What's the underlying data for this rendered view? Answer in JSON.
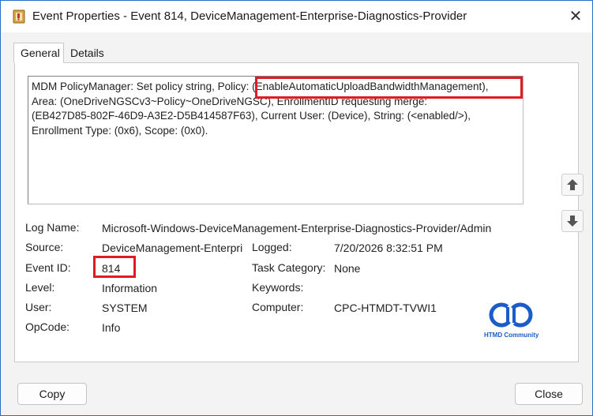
{
  "window": {
    "title": "Event Properties - Event 814, DeviceManagement-Enterprise-Diagnostics-Provider",
    "close_symbol": "✕"
  },
  "tabs": [
    {
      "label": "General",
      "active": true
    },
    {
      "label": "Details",
      "active": false
    }
  ],
  "message": {
    "line1_prefix": "MDM PolicyManager: Set policy string, Policy: ",
    "line1_highlight": "(EnableAutomaticUploadBandwidthManagement),",
    "line2": "Area: (OneDriveNGSCv3~Policy~OneDriveNGSC), EnrollmentID requesting merge:",
    "line3": "(EB427D85-802F-46D9-A3E2-D5B414587F63), Current User: (Device), String: (<enabled/>),",
    "line4": "Enrollment Type: (0x6), Scope: (0x0)."
  },
  "fields": {
    "log_name_label": "Log Name:",
    "log_name_value": "Microsoft-Windows-DeviceManagement-Enterprise-Diagnostics-Provider/Admin",
    "source_label": "Source:",
    "source_value": "DeviceManagement-Enterpri",
    "logged_label": "Logged:",
    "logged_value": "7/20/2026 8:32:51 PM",
    "event_id_label": "Event ID:",
    "event_id_value": "814",
    "task_category_label": "Task Category:",
    "task_category_value": "None",
    "level_label": "Level:",
    "level_value": "Information",
    "keywords_label": "Keywords:",
    "keywords_value": "",
    "user_label": "User:",
    "user_value": "SYSTEM",
    "computer_label": "Computer:",
    "computer_value": "CPC-HTMDT-TVWI1",
    "opcode_label": "OpCode:",
    "opcode_value": "Info"
  },
  "watermark": {
    "caption": "HTMD Community"
  },
  "buttons": {
    "copy": "Copy",
    "close": "Close"
  },
  "icons": {
    "app": "event-viewer-icon",
    "scroll_up": "arrow-up-icon",
    "scroll_down": "arrow-down-icon",
    "close": "close-icon"
  },
  "colors": {
    "highlight": "#e01b24",
    "accent": "#2b6cc4",
    "logo": "#1a5cc8"
  }
}
